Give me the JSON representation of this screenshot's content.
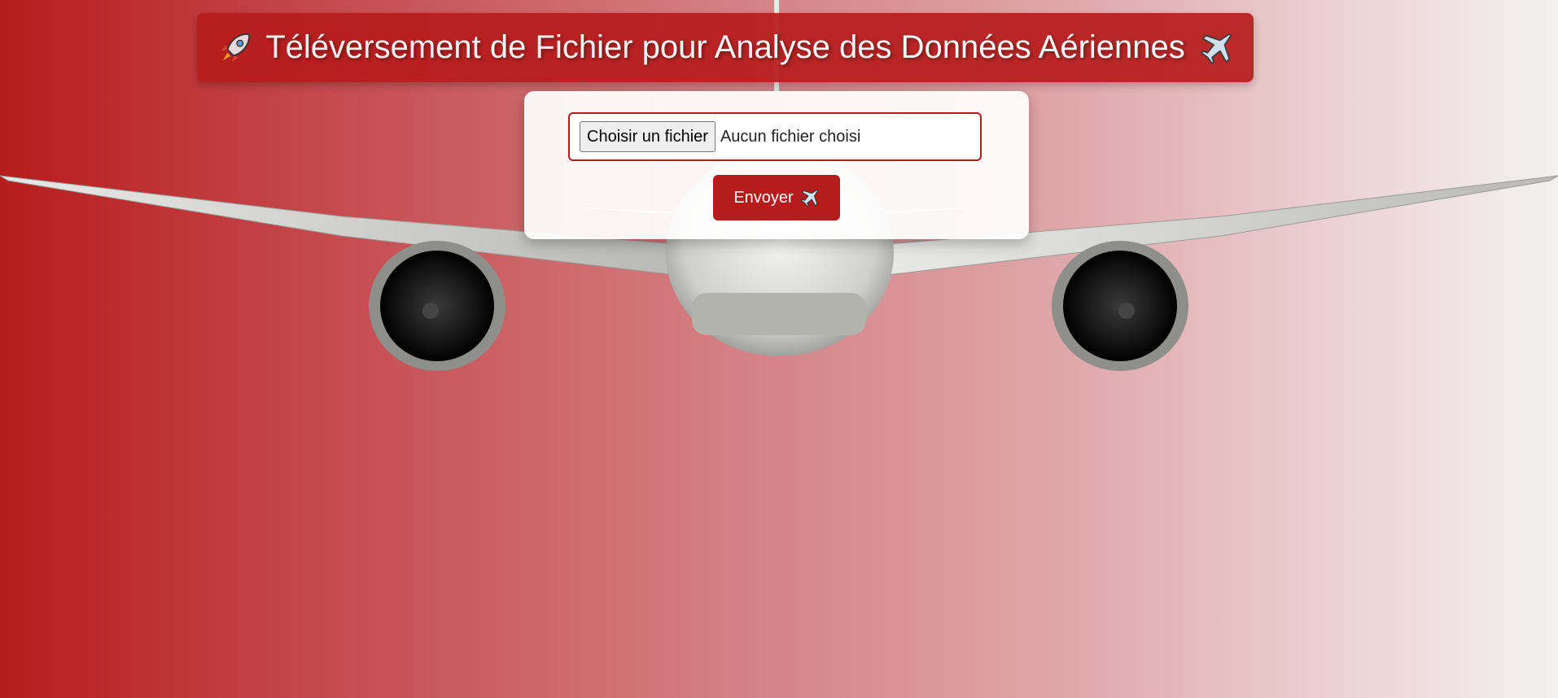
{
  "header": {
    "title": "Téléversement de Fichier pour Analyse des Données Aériennes",
    "leading_icon": "rocket-icon",
    "trailing_icon": "airplane-icon"
  },
  "upload_form": {
    "choose_button_label": "Choisir un fichier",
    "no_file_text": "Aucun fichier choisi",
    "submit_label": "Envoyer",
    "submit_icon": "airplane-icon"
  },
  "background": {
    "image": "airliner-front-view",
    "gradient_colors": [
      "#b71c1c",
      "#f3f1f1"
    ]
  },
  "colors": {
    "accent": "#b71c1c",
    "text_on_accent": "#ffffff"
  }
}
